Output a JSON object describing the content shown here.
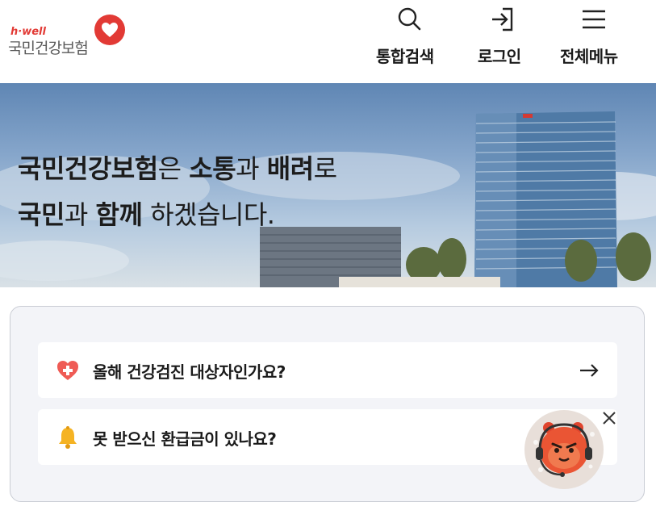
{
  "header": {
    "logo": {
      "small_text": "h·well",
      "main_text": "국민건강보험"
    },
    "nav": [
      {
        "label": "통합검색",
        "icon": "search-icon"
      },
      {
        "label": "로그인",
        "icon": "login-icon"
      },
      {
        "label": "전체메뉴",
        "icon": "hamburger-menu-icon"
      }
    ]
  },
  "banner": {
    "line1": {
      "part1": "국민건강보험",
      "part2": "은 ",
      "part3": "소통",
      "part4": "과 ",
      "part5": "배려",
      "part6": "로"
    },
    "line2": {
      "part1": "국민",
      "part2": "과 ",
      "part3": "함께",
      "part4": " 하겠습니다."
    }
  },
  "quick_links": [
    {
      "label": "올해 건강검진 대상자인가요?",
      "icon": "health-heart-icon",
      "has_arrow": true
    },
    {
      "label": "못 받으신 환급금이 있나요?",
      "icon": "bell-icon",
      "has_arrow": false
    }
  ],
  "colors": {
    "brand_red": "#e23a35",
    "card_bg": "#f3f4f8",
    "bell_yellow": "#f5b323"
  }
}
